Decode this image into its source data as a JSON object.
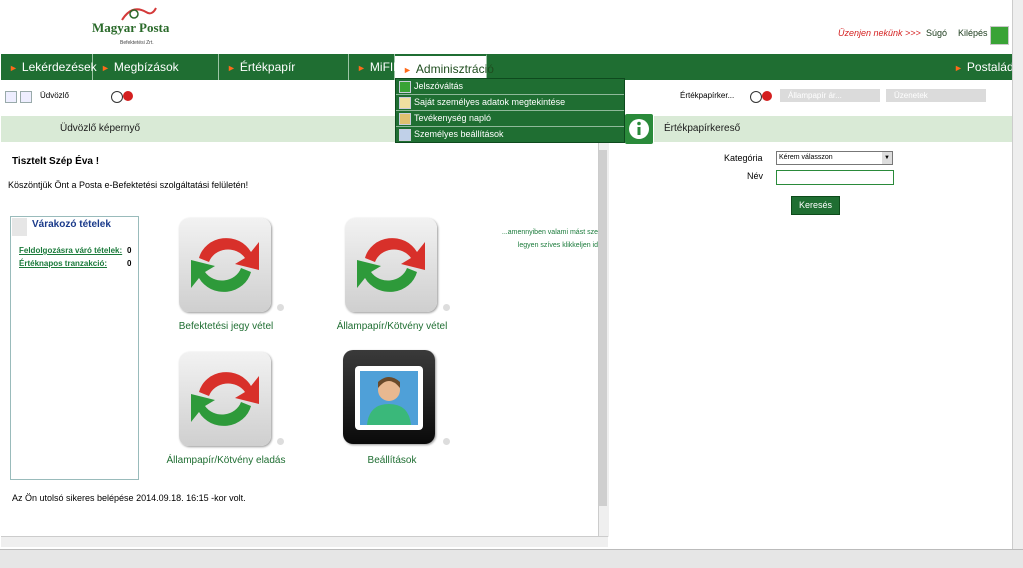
{
  "header": {
    "logo_text": "Magyar Posta",
    "logo_subtext": "Befektetési Zrt.",
    "contact_link": "Üzenjen nekünk >>>",
    "help_link": "Súgó",
    "logout_link": "Kilépés"
  },
  "nav": {
    "items": [
      {
        "label": "Lekérdezések"
      },
      {
        "label": "Megbízások rögzítése"
      },
      {
        "label": "Értékpapír információk"
      },
      {
        "label": "MiFID"
      },
      {
        "label": "Adminisztráció"
      }
    ],
    "right_label": "Postaláda",
    "accent_color": "#1f6e32"
  },
  "toolbar": {
    "welcome_tab": "Üdvözlő",
    "search_tab": "Értékpapírker...",
    "right_tabs": [
      {
        "label": "Állampapír ár..."
      },
      {
        "label": "Üzenetek"
      }
    ]
  },
  "admin_menu": {
    "items": [
      {
        "label": "Jelszóváltás",
        "icon": "key-icon"
      },
      {
        "label": "Saját személyes adatok megtekintése",
        "icon": "document-icon"
      },
      {
        "label": "Tevékenység napló",
        "icon": "log-icon"
      },
      {
        "label": "Személyes beállítások",
        "icon": "settings-icon"
      }
    ]
  },
  "left_panel": {
    "title": "Üdvözlő képernyő",
    "greeting": "Tisztelt  Szép Éva !",
    "welcome": "Köszöntjük Önt a Posta e-Befektetési szolgáltatási felületén!",
    "waiting": {
      "title": "Várakozó tételek",
      "rows": [
        {
          "label": "Feldolgozásra váró tételek:",
          "value": "0"
        },
        {
          "label": "Értéknapos tranzakció:",
          "value": "0"
        }
      ]
    },
    "tiles": [
      {
        "label": "Befektetési jegy vétel",
        "icon": "refresh-arrows-icon"
      },
      {
        "label": "Állampapír/Kötvény vétel",
        "icon": "refresh-arrows-icon"
      },
      {
        "label": "Állampapír/Kötvény eladás",
        "icon": "refresh-arrows-icon"
      },
      {
        "label": "Beállítások",
        "icon": "user-avatar-icon"
      }
    ],
    "info_text": "...amennyiben valami mást sze legyen szíves klikkeljen id",
    "last_login": "Az Ön utolsó sikeres belépése 2014.09.18. 16:15 -kor volt."
  },
  "right_panel": {
    "title": "Értékpapírkereső",
    "category_label": "Kategória",
    "category_value": "Kérem válasszon",
    "name_label": "Név",
    "name_value": "",
    "search_button": "Keresés"
  }
}
